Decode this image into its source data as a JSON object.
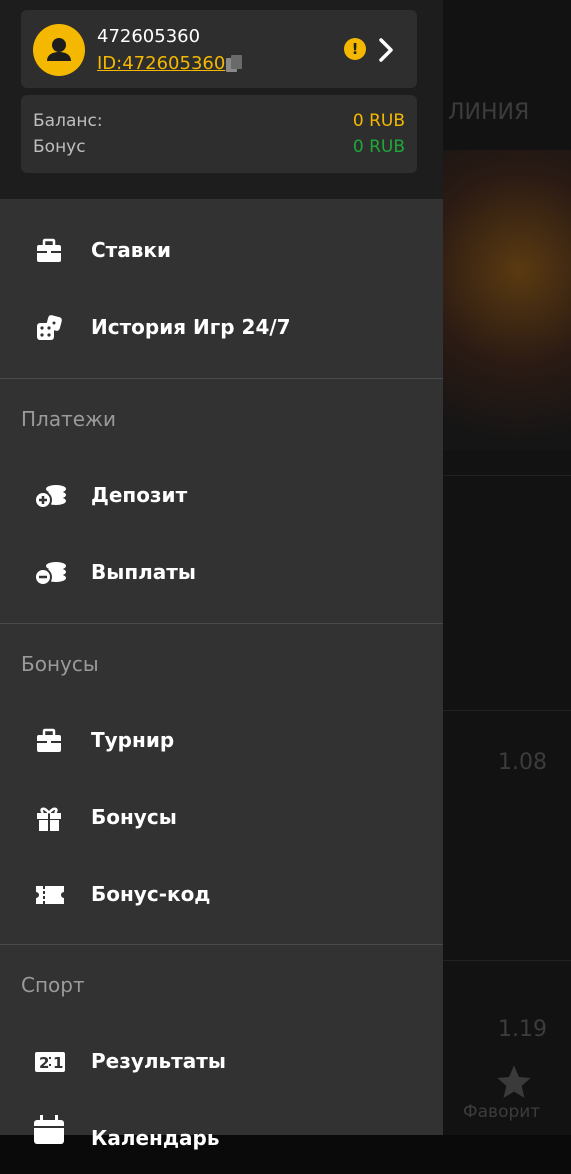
{
  "header": {
    "username": "472605360",
    "user_id": "ID:472605360",
    "balance_label": "Баланс:",
    "balance_value": "0 RUB",
    "bonus_label": "Бонус",
    "bonus_value": "0 RUB",
    "warning_glyph": "!"
  },
  "menu": {
    "bets": "Ставки",
    "history": "История Игр 24/7",
    "payments_title": "Платежи",
    "deposit": "Депозит",
    "withdraw": "Выплаты",
    "bonuses_title": "Бонусы",
    "tournament": "Турнир",
    "bonuses": "Бонусы",
    "bonus_code": "Бонус-код",
    "sport_title": "Спорт",
    "results": "Результаты",
    "calendar": "Календарь"
  },
  "background": {
    "tab_label": "ЛИНИЯ",
    "odds_1": "1.08",
    "odds_2": "1.19",
    "favorites_label": "Фаворит"
  },
  "colors": {
    "accent": "#f5b800",
    "bonus_green": "#1fa83a",
    "drawer_bg": "#323232",
    "header_bg": "#1d1d1d"
  }
}
